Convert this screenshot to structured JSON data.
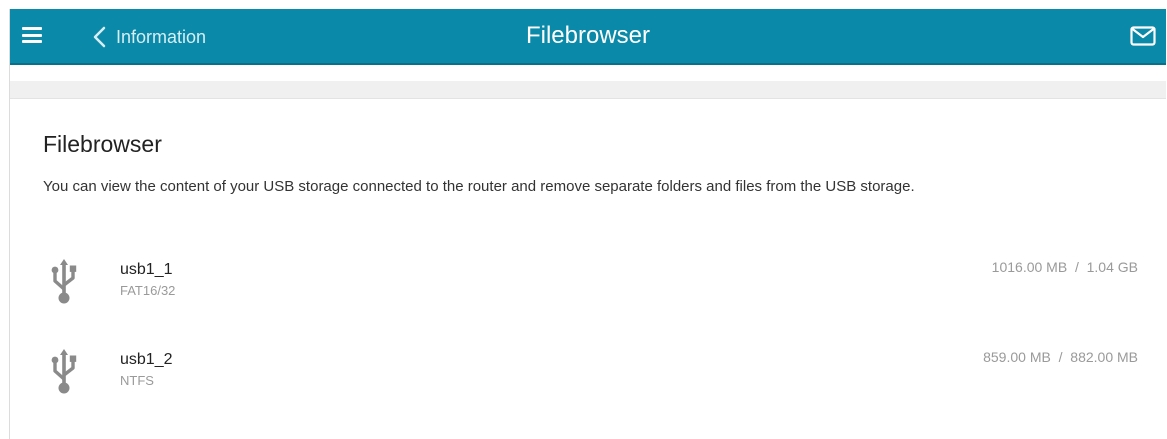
{
  "header": {
    "back_label": "Information",
    "title": "Filebrowser",
    "color": "#0b89a8",
    "menu_icon": "hamburger-icon",
    "back_icon": "chevron-left-icon",
    "notification_icon": "mail-icon"
  },
  "main": {
    "section_title": "Filebrowser",
    "description": "You can view the content of your USB storage connected to the router and remove separate folders and files from the USB storage."
  },
  "storages": [
    {
      "name": "usb1_1",
      "filesystem": "FAT16/32",
      "used": "1016.00 MB",
      "total": "1.04 GB",
      "icon": "usb-icon"
    },
    {
      "name": "usb1_2",
      "filesystem": "NTFS",
      "used": "859.00 MB",
      "total": "882.00 MB",
      "icon": "usb-icon"
    }
  ]
}
